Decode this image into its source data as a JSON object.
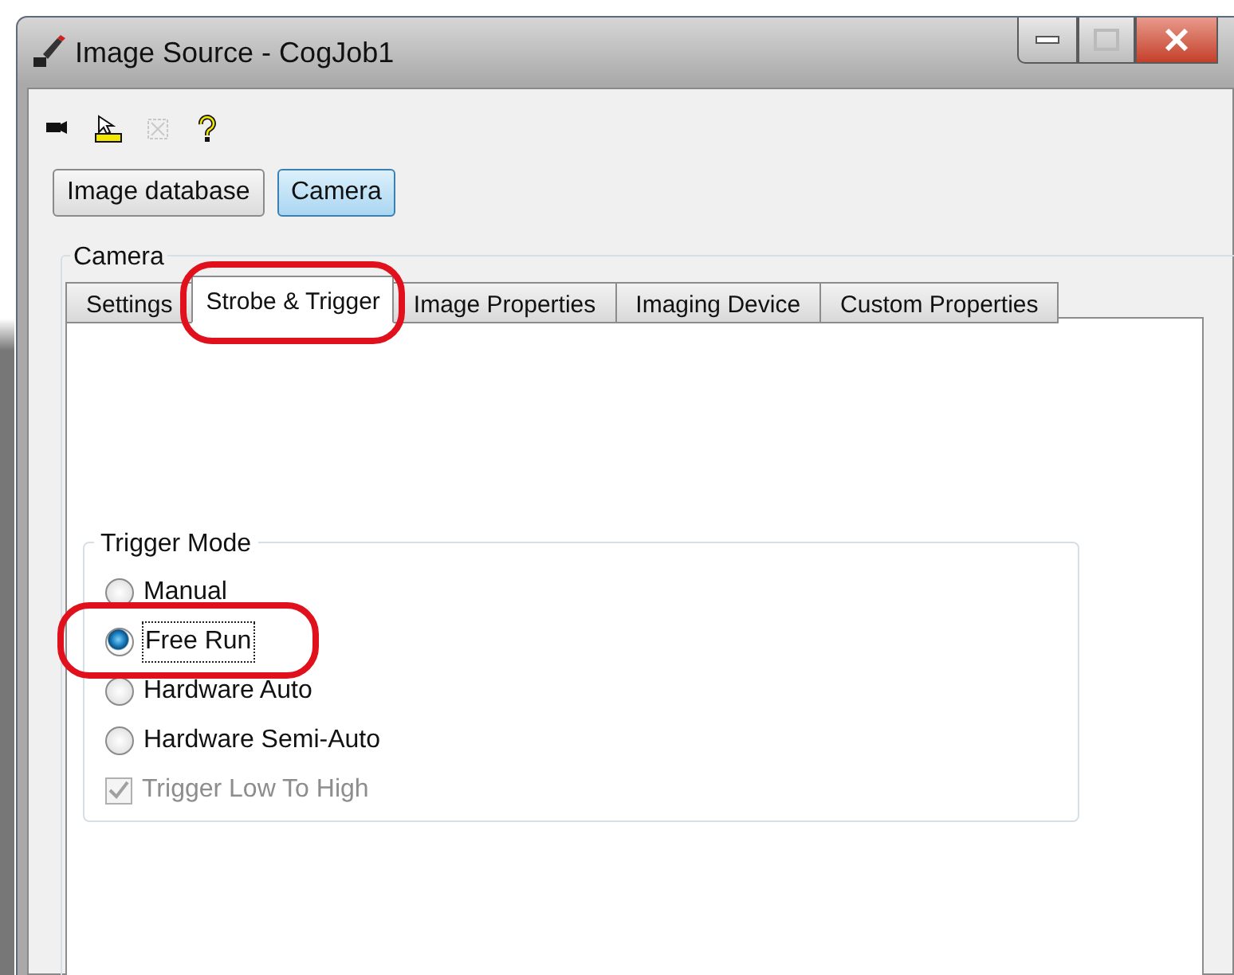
{
  "window": {
    "title": "Image Source - CogJob1"
  },
  "toolbar": [
    {
      "disabled": false
    },
    {
      "disabled": false
    },
    {
      "disabled": true
    },
    {
      "disabled": false
    }
  ],
  "source_buttons": [
    {
      "label": "Image database",
      "selected": false
    },
    {
      "label": "Camera",
      "selected": true
    }
  ],
  "group": {
    "title": "Camera"
  },
  "tabs": [
    {
      "label": "Settings",
      "selected": false,
      "highlighted": false
    },
    {
      "label": "Strobe & Trigger",
      "selected": true,
      "highlighted": true
    },
    {
      "label": "Image Properties",
      "selected": false,
      "highlighted": false
    },
    {
      "label": "Imaging Device",
      "selected": false,
      "highlighted": false
    },
    {
      "label": "Custom Properties",
      "selected": false,
      "highlighted": false
    }
  ],
  "trigger_mode": {
    "title": "Trigger Mode",
    "options": [
      {
        "kind": "radio",
        "label": "Manual",
        "selected": false,
        "focused": false,
        "highlighted": false
      },
      {
        "kind": "radio",
        "label": "Free Run",
        "selected": true,
        "focused": true,
        "highlighted": true
      },
      {
        "kind": "radio",
        "label": "Hardware Auto",
        "selected": false,
        "focused": false,
        "highlighted": false
      },
      {
        "kind": "radio",
        "label": "Hardware Semi-Auto",
        "selected": false,
        "focused": false,
        "highlighted": false
      },
      {
        "kind": "checkbox",
        "label": "Trigger Low To High",
        "checked": true,
        "disabled": true,
        "highlighted": false
      }
    ]
  }
}
